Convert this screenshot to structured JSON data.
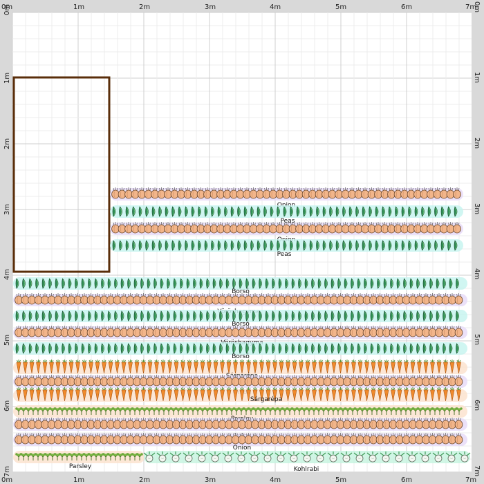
{
  "ruler": {
    "unit": "m",
    "labels": [
      "0m",
      "1m",
      "2m",
      "3m",
      "4m",
      "5m",
      "6m",
      "7m"
    ]
  },
  "colors": {
    "ruler_bg": "#d9d9d9",
    "grid_bg": "#ffffff",
    "grid_minor": "#ececec",
    "grid_major": "#cfcfcf",
    "bed_border": "#5a2e0a"
  },
  "rows": [
    {
      "plant": "onion",
      "label": "Onion"
    },
    {
      "plant": "peas",
      "label": "Peas"
    },
    {
      "plant": "onion",
      "label": "Onion"
    },
    {
      "plant": "peas",
      "label": "Peas"
    },
    {
      "plant": "peas",
      "label": "Borsó"
    },
    {
      "plant": "onion",
      "label": "Vöröshagyma"
    },
    {
      "plant": "peas",
      "label": "Borsó"
    },
    {
      "plant": "onion",
      "label": "Vöröshagyma"
    },
    {
      "plant": "peas",
      "label": "Borsó"
    },
    {
      "plant": "carrot",
      "label": "Sárgarépa"
    },
    {
      "plant": "onion",
      "label": "Onion"
    },
    {
      "plant": "carrot",
      "label": "Sárgarépa"
    },
    {
      "plant": "parsley",
      "label": "Parsley"
    },
    {
      "plant": "onion",
      "label": "Onion"
    },
    {
      "plant": "onion",
      "label": "Onion"
    },
    {
      "plant": "parsley",
      "label": "Parsley"
    },
    {
      "plant": "kohlrabi",
      "label": "Kohlrabi"
    }
  ]
}
